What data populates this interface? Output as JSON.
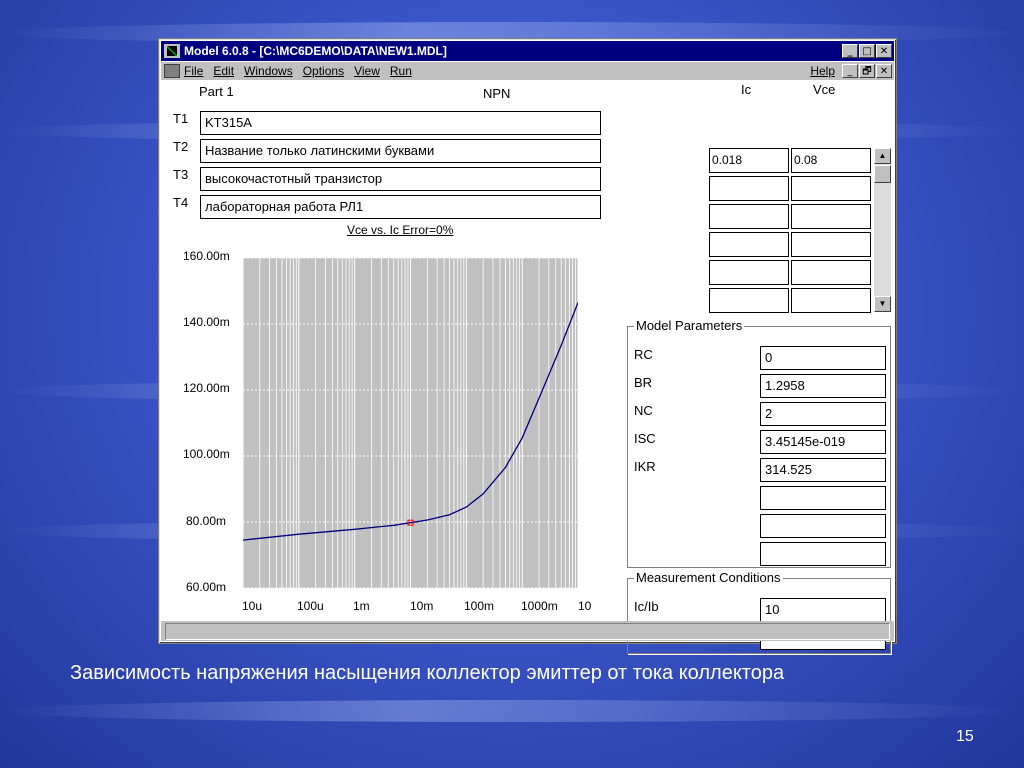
{
  "window": {
    "title": "Model 6.0.8 - [C:\\MC6DEMO\\DATA\\NEW1.MDL]",
    "minimize": "_",
    "maximize": "□",
    "close": "✕",
    "restore": "🗗"
  },
  "menu": {
    "items": [
      "File",
      "Edit",
      "Windows",
      "Options",
      "View",
      "Run"
    ],
    "help": "Help"
  },
  "header": {
    "part": "Part 1",
    "type": "NPN",
    "col_ic": "Ic",
    "col_vce": "Vce"
  },
  "fields": [
    {
      "label": "T1",
      "value": "KT315A"
    },
    {
      "label": "T2",
      "value": "Название только латинскими буквами"
    },
    {
      "label": "T3",
      "value": "высокочастотный транзистор"
    },
    {
      "label": "T4",
      "value": "лабораторная работа РЛ1"
    }
  ],
  "table": {
    "rows": [
      [
        "0.018",
        "0.08"
      ],
      [
        "",
        ""
      ],
      [
        "",
        ""
      ],
      [
        "",
        ""
      ],
      [
        "",
        ""
      ],
      [
        "",
        ""
      ]
    ]
  },
  "model_params": {
    "title": "Model Parameters",
    "params": [
      {
        "name": "RC",
        "value": "0"
      },
      {
        "name": "BR",
        "value": "1.2958"
      },
      {
        "name": "NC",
        "value": "2"
      },
      {
        "name": "ISC",
        "value": "3.45145e-019"
      },
      {
        "name": "IKR",
        "value": "314.525"
      },
      {
        "name": "",
        "value": ""
      },
      {
        "name": "",
        "value": ""
      },
      {
        "name": "",
        "value": ""
      }
    ]
  },
  "measurement": {
    "title": "Measurement Conditions",
    "rows": [
      {
        "name": "Ic/Ib",
        "value": "10"
      },
      {
        "name": "",
        "value": ""
      }
    ]
  },
  "chart_data": {
    "type": "line",
    "title": "Vce vs. Ic Error=0%",
    "x_scale": "log",
    "xlim": [
      1e-05,
      10
    ],
    "ylim": [
      0.06,
      0.16
    ],
    "x_tick_labels": [
      "10u",
      "100u",
      "1m",
      "10m",
      "100m",
      "1000m",
      "10"
    ],
    "y_tick_labels": [
      "160.00m",
      "140.00m",
      "120.00m",
      "100.00m",
      "80.00m",
      "60.00m"
    ],
    "grid": true,
    "series": [
      {
        "x": [
          1e-05,
          0.0001,
          0.001,
          0.005,
          0.01,
          0.02,
          0.05,
          0.1,
          0.2,
          0.5,
          1,
          2,
          5,
          10
        ],
        "y": [
          0.0745,
          0.0763,
          0.0778,
          0.079,
          0.0798,
          0.0806,
          0.0822,
          0.0845,
          0.0885,
          0.0965,
          0.1055,
          0.1175,
          0.1335,
          0.1465
        ]
      }
    ],
    "points": [
      {
        "x": 0.01,
        "y": 0.0798
      }
    ],
    "colors": {
      "line": "#000080",
      "point": "#ff0000",
      "plot_bg": "#c0c0c0",
      "grid": "#ffffff"
    }
  },
  "caption": "Зависимость напряжения насыщения коллектор эмиттер от тока коллектора",
  "page_number": "15"
}
